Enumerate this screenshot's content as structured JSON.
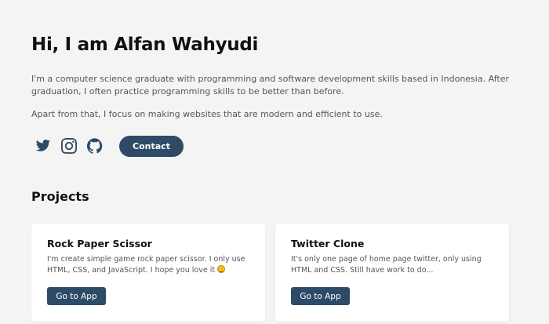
{
  "hero": {
    "title": "Hi, I am Alfan Wahyudi",
    "bio_1": "I'm a computer science graduate with programming and software development skills based in Indonesia. After graduation, I often practice programming skills to be better than before.",
    "bio_2": "Apart from that, I focus on making websites that are modern and efficient to use."
  },
  "socials": [
    {
      "icon": "twitter-icon"
    },
    {
      "icon": "instagram-icon"
    },
    {
      "icon": "github-icon"
    }
  ],
  "contact": {
    "label": "Contact"
  },
  "projects": {
    "title": "Projects",
    "items": [
      {
        "title": "Rock Paper Scissor",
        "description": "I'm create simple game rock paper scissor. I only use HTML, CSS, and JavaScript. I hope you love it",
        "emoji": "smiling-face-icon",
        "button": "Go to App"
      },
      {
        "title": "Twitter Clone",
        "description": "It's only one page of home page twitter, only using HTML and CSS. Still have work to do...",
        "button": "Go to App"
      }
    ]
  },
  "colors": {
    "background": "#f4f4f4",
    "accent": "#2d4b66",
    "text": "#111111",
    "muted": "#555555",
    "card": "#ffffff"
  }
}
